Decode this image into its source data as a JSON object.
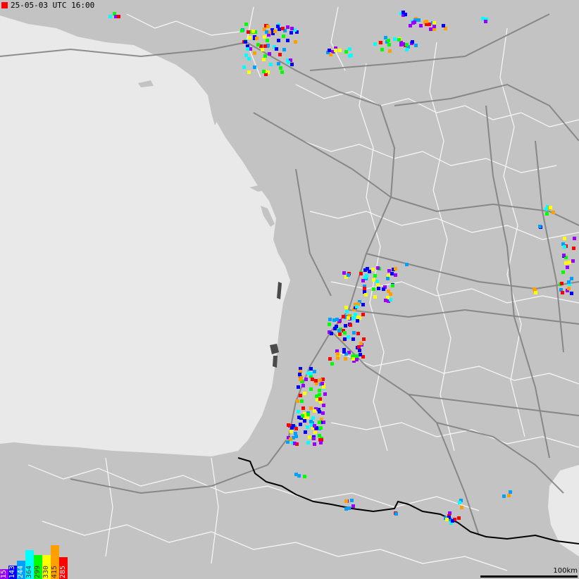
{
  "title": {
    "timestamp": "25-05-03 UTC 16:00",
    "marker_color": "#ff0000"
  },
  "legend": {
    "items": [
      {
        "value": "157",
        "color": "#9900ff",
        "level": 0.3
      },
      {
        "value": "143",
        "color": "#0000ff",
        "level": 0.4
      },
      {
        "value": "244",
        "color": "#00a0ff",
        "level": 0.55
      },
      {
        "value": "364",
        "color": "#00ffff",
        "level": 0.85
      },
      {
        "value": "299",
        "color": "#00ff00",
        "level": 0.7
      },
      {
        "value": "330",
        "color": "#ffff00",
        "level": 0.7
      },
      {
        "value": "415",
        "color": "#ffa000",
        "level": 1.0
      },
      {
        "value": "285",
        "color": "#ff0000",
        "level": 0.65
      }
    ]
  },
  "scale_bar": {
    "label": "100km"
  },
  "map_style": {
    "sea_color": "#e9e9e9",
    "land_color": "#c3c3c3",
    "road_color": "#7d7d7d",
    "boundary_color": "#ffffff",
    "border_color": "#000000",
    "lake_color": "#4a4a4a"
  }
}
